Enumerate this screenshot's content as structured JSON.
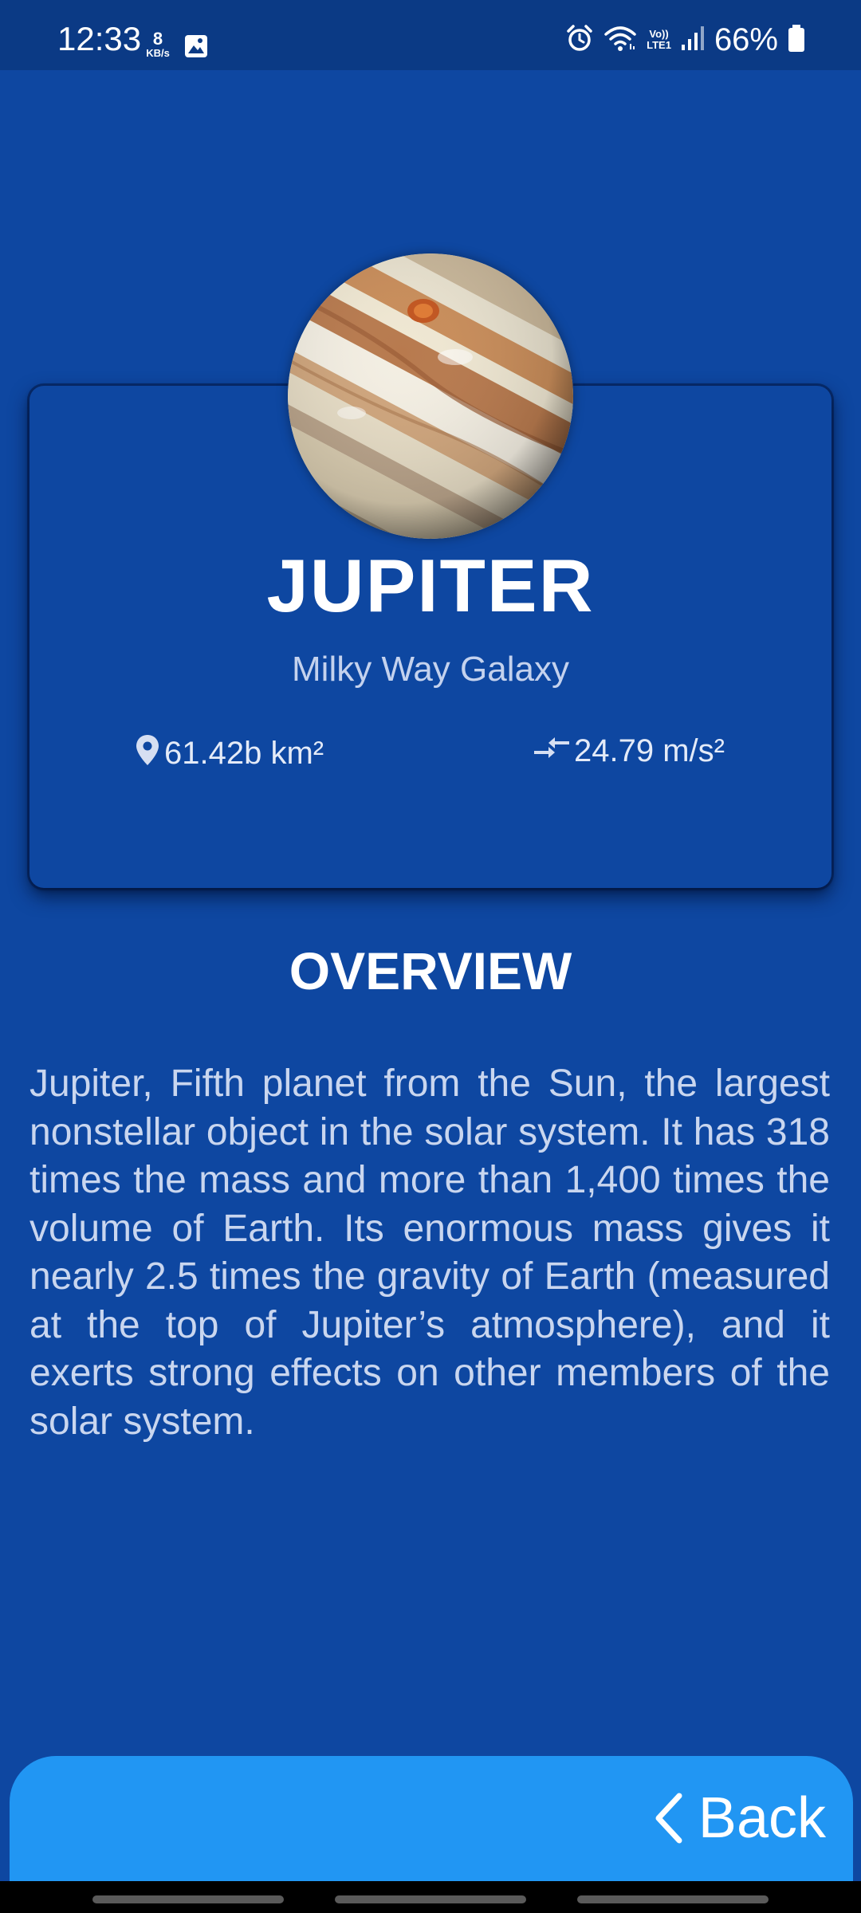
{
  "status_bar": {
    "time": "12:33",
    "net_speed_value": "8",
    "net_speed_unit": "KB/s",
    "volte_top": "Vo))",
    "volte_bottom": "LTE1",
    "battery_percent": "66%"
  },
  "planet": {
    "name": "JUPITER",
    "galaxy": "Milky Way Galaxy",
    "area": "61.42b km²",
    "gravity": "24.79 m/s²",
    "image_icon": "jupiter-planet-image"
  },
  "overview": {
    "title": "OVERVIEW",
    "text": "Jupiter, Fifth planet from the Sun, the largest nonstellar object in the solar system. It has 318 times the mass and more than 1,400 times the volume of Earth. Its enormous mass gives it nearly 2.5 times the gravity of Earth (measured at the top of Jupiter’s atmosphere), and it exerts strong effects on other members of the solar system."
  },
  "footer": {
    "back_label": "Back"
  },
  "colors": {
    "background": "#0e47a1",
    "status_bar": "#0b3a85",
    "back_bar": "#2196f3",
    "text_secondary": "#c4d2ee"
  },
  "icons": {
    "status": [
      "gallery-icon",
      "alarm-icon",
      "wifi-icon",
      "signal-icon",
      "battery-icon"
    ],
    "area": "location-pin-icon",
    "gravity": "compare-arrows-icon",
    "back": "chevron-left-icon"
  }
}
